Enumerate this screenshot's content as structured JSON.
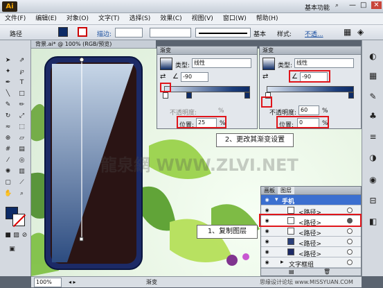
{
  "app": {
    "logo": "Ai",
    "workspace": "基本功能",
    "win_min": "—",
    "win_max": "□",
    "win_close": "✕"
  },
  "menu": [
    "文件(F)",
    "编辑(E)",
    "对象(O)",
    "文字(T)",
    "选择(S)",
    "效果(C)",
    "视图(V)",
    "窗口(W)",
    "帮助(H)"
  ],
  "control": {
    "object_type": "路径",
    "stroke_label": "描边:",
    "preset": "基本",
    "opacity_label": "样式:",
    "link_label": "不透..."
  },
  "document": {
    "tab": "背景.ai* @ 100% (RGB/预览)",
    "watermark": "龍泉網 WWW.ZLVI.NET"
  },
  "gradient_left": {
    "title": "渐变",
    "type_label": "类型:",
    "type_value": "线性",
    "angle": "-90",
    "opacity_label": "不透明度:",
    "opacity_unit": "%",
    "position_label": "位置:",
    "position_value": "25",
    "position_unit": "%"
  },
  "gradient_right": {
    "title": "渐变",
    "type_label": "类型:",
    "type_value": "线性",
    "angle": "-90",
    "opacity_label": "不透明度:",
    "opacity_value": "60",
    "opacity_unit": "%",
    "position_label": "位置:",
    "position_value": "0",
    "position_unit": "%"
  },
  "callouts": {
    "step2": "2、更改其渐变设置",
    "step1": "1、复制图层"
  },
  "layers": {
    "tabs": [
      "画板",
      "图层"
    ],
    "group": "手机",
    "rows": [
      "<路径>",
      "<路径>",
      "<路径>",
      "<路径>",
      "<路径>",
      "文字框组"
    ]
  },
  "status": {
    "zoom": "100%",
    "label": "渐变",
    "credit": "思缘设计论坛 www.MISSYUAN.COM"
  },
  "colors": {
    "accent": "#e0141a",
    "gradient_dark": "#0d2b66"
  }
}
